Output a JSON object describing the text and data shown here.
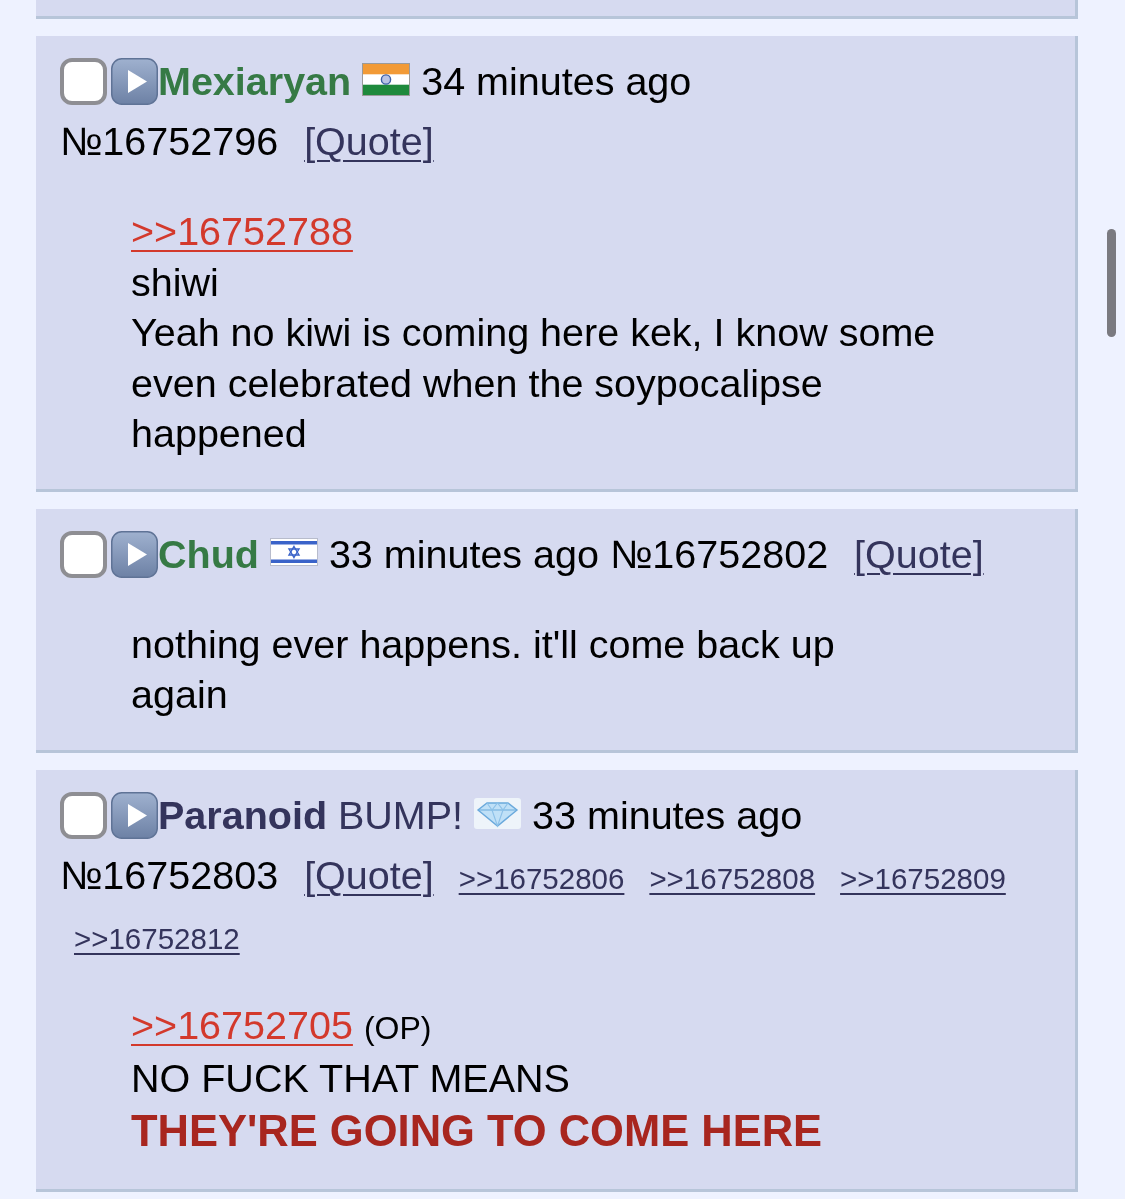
{
  "posts": [
    {
      "checked": false,
      "name": {
        "text": "Mexiaryan",
        "color": "#367a45"
      },
      "flag": {
        "kind": "india"
      },
      "time": "34 minutes ago",
      "number": "№16752796",
      "quote_link": "[Quote]",
      "message": [
        {
          "kind": "reply",
          "text": ">>16752788"
        },
        {
          "kind": "text",
          "text": "shiwi"
        },
        {
          "kind": "text",
          "text": "Yeah no kiwi is coming here kek, I know some even celebrated when the soypocalipse happened"
        }
      ]
    },
    {
      "checked": false,
      "name": {
        "text": "Chud",
        "color": "#367a45"
      },
      "flag": {
        "kind": "israel"
      },
      "time": "33 minutes ago",
      "number": "№16752802",
      "quote_link": "[Quote]",
      "message": [
        {
          "kind": "text",
          "text": "nothing ever happens. it'll come back up again"
        }
      ]
    },
    {
      "checked": false,
      "name": {
        "text": "Paranoid",
        "color": "#34345c"
      },
      "capcode": "BUMP!",
      "flag": {
        "kind": "diamond"
      },
      "time": "33 minutes ago",
      "number": "№16752803",
      "quote_link": "[Quote]",
      "backlinks": [
        ">>16752806",
        ">>16752808",
        ">>16752809",
        ">>16752812"
      ],
      "message": [
        {
          "kind": "reply",
          "text": ">>16752705",
          "note": "(OP)"
        },
        {
          "kind": "text",
          "text": "NO FUCK THAT MEANS"
        },
        {
          "kind": "heavy",
          "text": "THEY'RE GOING TO COME HERE"
        }
      ]
    }
  ]
}
